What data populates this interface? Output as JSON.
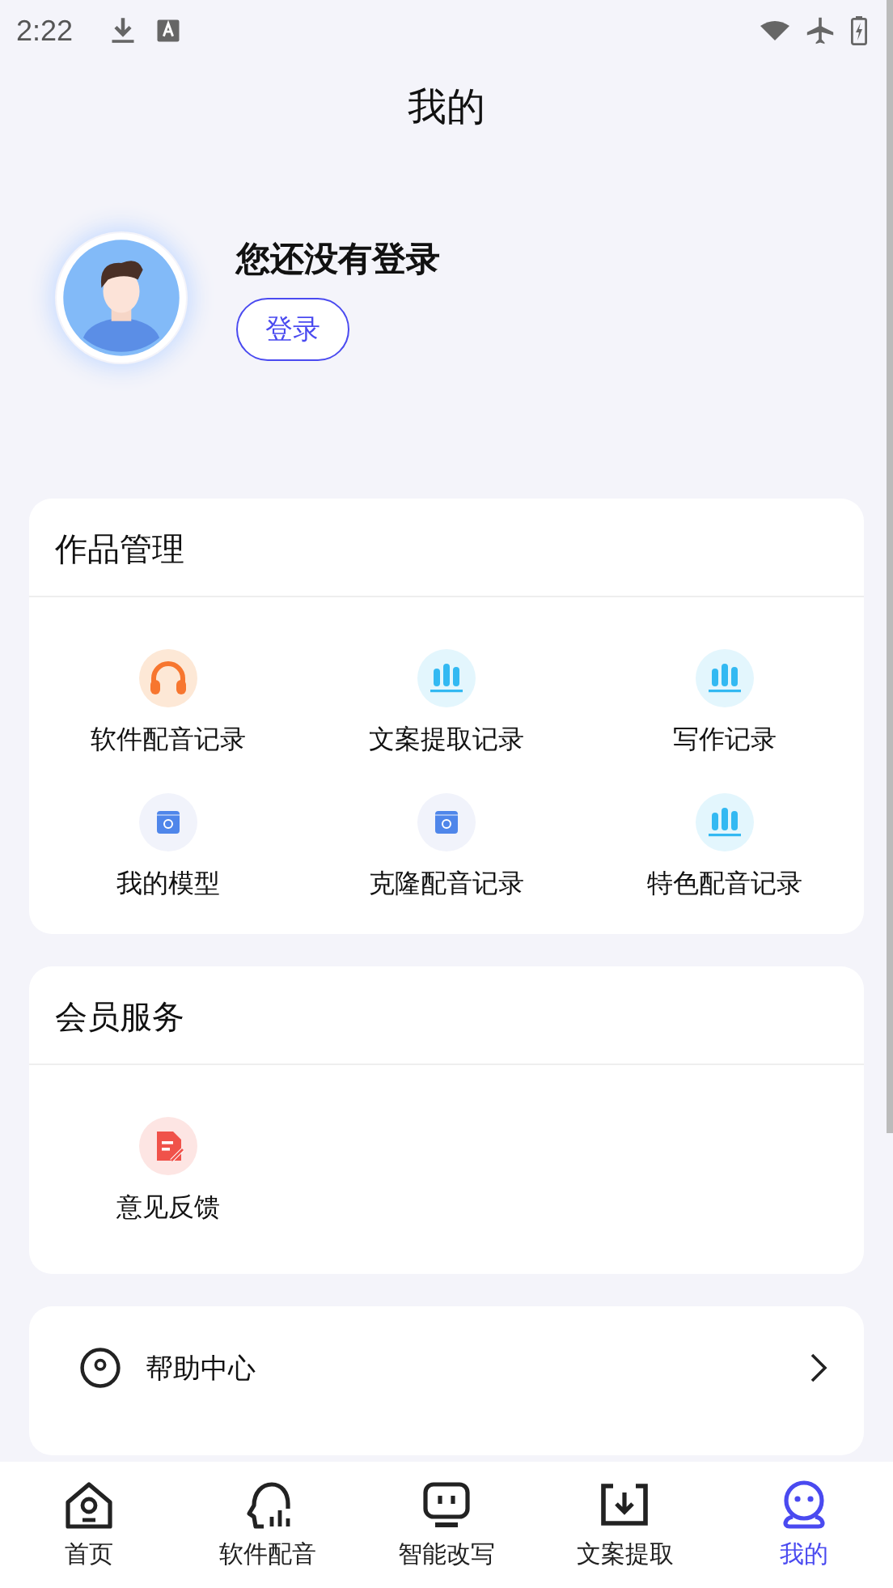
{
  "status_bar": {
    "time": "2:22"
  },
  "header": {
    "title": "我的"
  },
  "profile": {
    "name": "您还没有登录",
    "login_button": "登录"
  },
  "works": {
    "title": "作品管理",
    "items": [
      {
        "label": "软件配音记录",
        "kind": "headphones"
      },
      {
        "label": "文案提取记录",
        "kind": "bars"
      },
      {
        "label": "写作记录",
        "kind": "bars"
      },
      {
        "label": "我的模型",
        "kind": "box"
      },
      {
        "label": "克隆配音记录",
        "kind": "box"
      },
      {
        "label": "特色配音记录",
        "kind": "bars"
      }
    ]
  },
  "membership": {
    "title": "会员服务",
    "items": [
      {
        "label": "意见反馈",
        "kind": "feedback"
      }
    ]
  },
  "help": {
    "label": "帮助中心"
  },
  "tab_bar": [
    {
      "label": "首页",
      "kind": "home",
      "selected": false
    },
    {
      "label": "软件配音",
      "kind": "voice",
      "selected": false
    },
    {
      "label": "智能改写",
      "kind": "robot",
      "selected": false
    },
    {
      "label": "文案提取",
      "kind": "download",
      "selected": false
    },
    {
      "label": "我的",
      "kind": "me",
      "selected": true
    }
  ]
}
